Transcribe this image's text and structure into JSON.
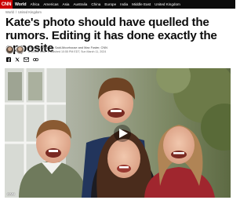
{
  "header": {
    "logo": "CNN",
    "nav": [
      "World",
      "Africa",
      "Americas",
      "Asia",
      "Australia",
      "China",
      "Europe",
      "India",
      "Middle East",
      "United Kingdom"
    ]
  },
  "breadcrumb": [
    "World",
    "/",
    "United Kingdom"
  ],
  "article": {
    "headline": "Kate's photo should have quelled the rumors. Editing it has done exactly the opposite",
    "authors": "Analysis by Lauren Said-Moorhouse and Max Foster, CNN",
    "meta": "5 minute read · Published 10:55 PM EDT, Sun March 11, 2024",
    "photo_credit": "CNN"
  },
  "icons": [
    "facebook-icon",
    "x-icon",
    "email-icon",
    "link-icon"
  ],
  "colors": {
    "brand": "#cc0000",
    "topbar": "#0c0c0c",
    "headline": "#0c0c0c",
    "meta": "#6b6b6b"
  }
}
